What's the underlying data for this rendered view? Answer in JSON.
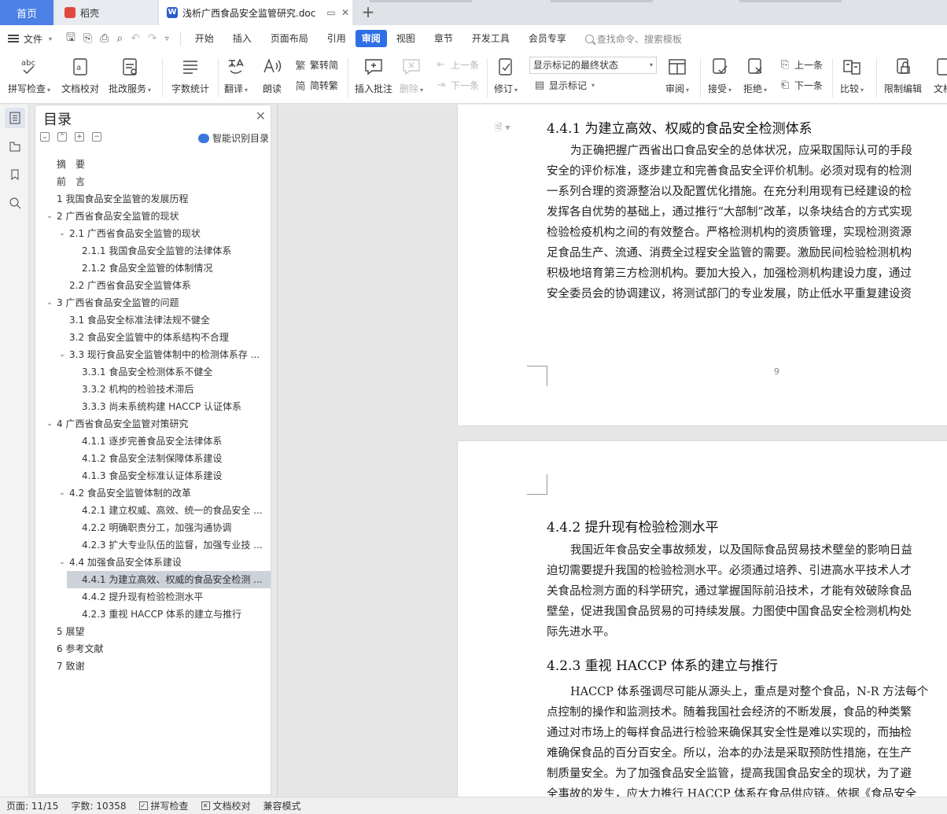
{
  "tabs": {
    "home": "首页",
    "daoke": "稻壳",
    "document": "浅析广西食品安全监管研究.doc",
    "add": "+"
  },
  "menu": {
    "file": "文件",
    "items": [
      "开始",
      "插入",
      "页面布局",
      "引用",
      "审阅",
      "视图",
      "章节",
      "开发工具",
      "会员专享"
    ],
    "active": "审阅",
    "search_placeholder": "查找命令、搜索模板"
  },
  "ribbon": {
    "spell_check": "拼写检查",
    "doc_proof": "文档校对",
    "batch_service": "批改服务",
    "word_count": "字数统计",
    "translate": "翻译",
    "read_aloud": "朗读",
    "to_simplified": "繁转简",
    "to_traditional": "简转繁",
    "insert_comment": "插入批注",
    "delete": "删除",
    "prev_comment": "上一条",
    "next_comment": "下一条",
    "revise": "修订",
    "markup_state": "显示标记的最终状态",
    "show_markup": "显示标记",
    "review": "审阅",
    "accept": "接受",
    "reject": "拒绝",
    "prev_change": "上一条",
    "next_change": "下一条",
    "compare": "比较",
    "restrict_edit": "限制编辑",
    "doc_right": "文档"
  },
  "toc": {
    "title": "目录",
    "smart": "智能识别目录",
    "items": [
      {
        "text": "摘　要"
      },
      {
        "text": "前　言"
      },
      {
        "text": "1 我国食品安全监管的发展历程"
      },
      {
        "text": "2 广西省食品安全监管的现状"
      },
      {
        "text": "2.1 广西省食品安全监管的现状"
      },
      {
        "text": "2.1.1 我国食品安全监管的法律体系"
      },
      {
        "text": "2.1.2 食品安全监管的体制情况"
      },
      {
        "text": "2.2 广西省食品安全监管体系"
      },
      {
        "text": "3 广西省食品安全监管的问题"
      },
      {
        "text": "3.1 食品安全标准法律法规不健全"
      },
      {
        "text": "3.2 食品安全监管中的体系结构不合理"
      },
      {
        "text": "3.3 现行食品安全监管体制中的检测体系存 ..."
      },
      {
        "text": "3.3.1 食品安全检测体系不健全"
      },
      {
        "text": "3.3.2 机构的检验技术滞后"
      },
      {
        "text": "3.3.3 尚未系统构建 HACCP 认证体系"
      },
      {
        "text": "4 广西省食品安全监管对策研究"
      },
      {
        "text": "4.1.1 逐步完善食品安全法律体系"
      },
      {
        "text": "4.1.2 食品安全法制保障体系建设"
      },
      {
        "text": "4.1.3 食品安全标准认证体系建设"
      },
      {
        "text": "4.2 食品安全监管体制的改革"
      },
      {
        "text": "4.2.1 建立权威、高效、统一的食品安全 ..."
      },
      {
        "text": "4.2.2 明确职责分工，加强沟通协调"
      },
      {
        "text": "4.2.3 扩大专业队伍的监督，加强专业技 ..."
      },
      {
        "text": "4.4 加强食品安全体系建设"
      },
      {
        "text": "4.4.1 为建立高效、权威的食品安全检测 ..."
      },
      {
        "text": "4.4.2 提升现有检验检测水平"
      },
      {
        "text": "4.2.3 重视 HACCP 体系的建立与推行"
      },
      {
        "text": "5 展望"
      },
      {
        "text": "6 参考文献"
      },
      {
        "text": "7 致谢"
      }
    ]
  },
  "doc": {
    "h1": "4.4.1 为建立高效、权威的食品安全检测体系",
    "p1": [
      "为正确把握广西省出口食品安全的总体状况，应采取国际认可的手段",
      "安全的评价标准，逐步建立和完善食品安全评价机制。必须对现有的检测",
      "一系列合理的资源整治以及配置优化措施。在充分利用现有已经建设的检",
      "发挥各自优势的基础上，通过推行“大部制”改革，以条块结合的方式实现",
      "检验检疫机构之间的有效整合。严格检测机构的资质管理，实现检测资源",
      "足食品生产、流通、消费全过程安全监管的需要。激励民间检验检测机构",
      "积极地培育第三方检测机构。要加大投入，加强检测机构建设力度，通过",
      "安全委员会的协调建议，将测试部门的专业发展，防止低水平重复建设资"
    ],
    "page_num": "9",
    "h2": "4.4.2 提升现有检验检测水平",
    "p2": [
      "我国近年食品安全事故频发，以及国际食品贸易技术壁垒的影响日益",
      "迫切需要提升我国的检验检测水平。必须通过培养、引进高水平技术人才",
      "关食品检测方面的科学研究，通过掌握国际前沿技术，才能有效破除食品",
      "壁垒，促进我国食品贸易的可持续发展。力图使中国食品安全检测机构处",
      "际先进水平。"
    ],
    "h3": "4.2.3 重视 HACCP 体系的建立与推行",
    "p3": [
      "HACCP 体系强调尽可能从源头上，重点是对整个食品，N-R 方法每个",
      "点控制的操作和监测技术。随着我国社会经济的不断发展，食品的种类繁",
      "通过对市场上的每样食品进行检验来确保其安全性是难以实现的，而抽检",
      "难确保食品的百分百安全。所以，治本的办法是采取预防性措施，在生产",
      "制质量安全。为了加强食品安全监管，提高我国食品安全的现状，为了避",
      "全事故的发生，应大力推行 HACCP 体系在食品供应链。依据《食品安全"
    ]
  },
  "status": {
    "page": "页面: 11/15",
    "words": "字数: 10358",
    "spell": "拼写检查",
    "proof": "文档校对",
    "compat": "兼容模式"
  },
  "colors": {
    "accent": "#2e6fe6",
    "home_tab": "#4d80e6",
    "selected_toc": "#cdd2da"
  }
}
